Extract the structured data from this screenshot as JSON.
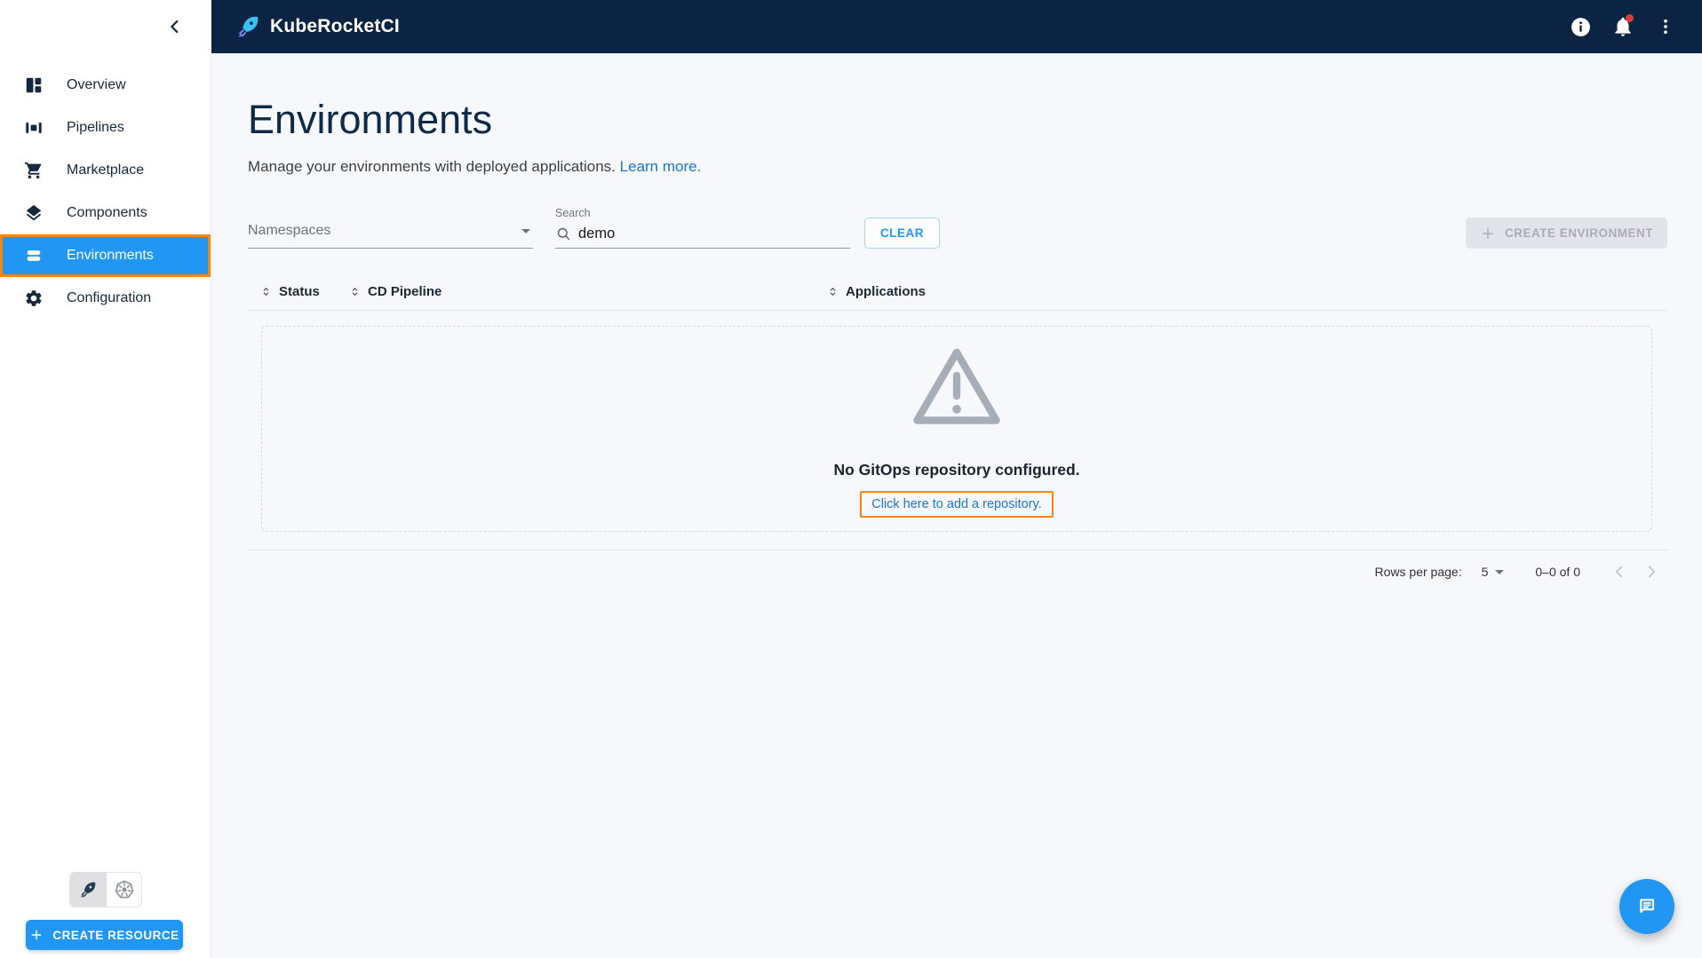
{
  "topbar": {
    "brand": "KubeRocketCI",
    "icons": {
      "info": "info-icon",
      "notifications": "bell-icon",
      "menu": "kebab-menu-icon"
    }
  },
  "sidebar": {
    "items": [
      {
        "label": "Overview",
        "icon": "dashboard-icon"
      },
      {
        "label": "Pipelines",
        "icon": "pipelines-icon"
      },
      {
        "label": "Marketplace",
        "icon": "cart-icon"
      },
      {
        "label": "Components",
        "icon": "layers-icon"
      },
      {
        "label": "Environments",
        "icon": "stacked-bars-icon",
        "active": true
      },
      {
        "label": "Configuration",
        "icon": "gear-icon"
      }
    ],
    "cluster_toggle": {
      "left_icon": "rocket-icon",
      "right_icon": "kubernetes-icon",
      "selected": "left"
    },
    "create_resource_label": "CREATE RESOURCE"
  },
  "page": {
    "title": "Environments",
    "subtitle": "Manage your environments with deployed applications.",
    "learn_more_label": "Learn more."
  },
  "filters": {
    "namespaces_label": "Namespaces",
    "search_label": "Search",
    "search_value": "demo",
    "clear_label": "CLEAR",
    "create_environment_label": "CREATE ENVIRONMENT"
  },
  "table": {
    "columns": [
      {
        "label": "Status"
      },
      {
        "label": "CD Pipeline"
      },
      {
        "label": "Applications"
      }
    ],
    "empty_state": {
      "icon": "warning-triangle-icon",
      "message": "No GitOps repository configured.",
      "action_label": "Click here to add a repository."
    },
    "pagination": {
      "rows_per_page_label": "Rows per page:",
      "rows_per_page_value": "5",
      "range_label": "0–0 of 0"
    }
  },
  "colors": {
    "topbar_navy": "#0C2444",
    "accent_blue": "#2196F3",
    "highlight_orange": "#F5860F",
    "link_blue": "#1976D2",
    "notification_red": "#E53935"
  }
}
